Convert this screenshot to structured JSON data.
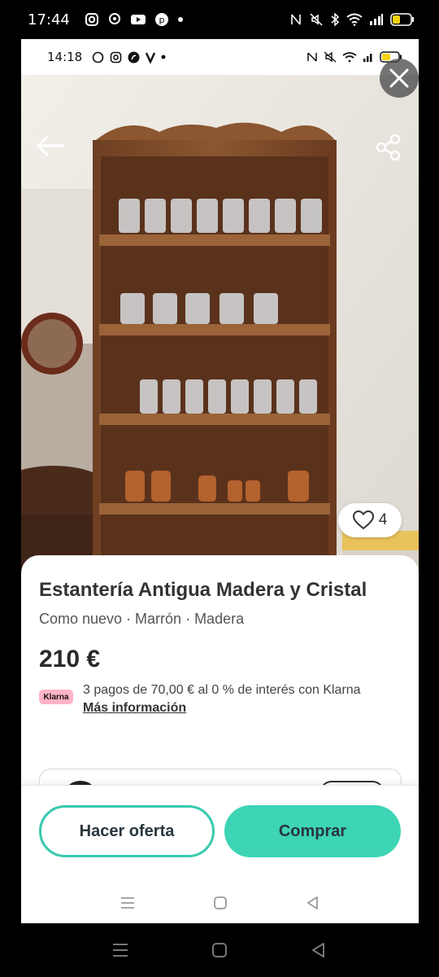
{
  "outer_status": {
    "time": "17:44"
  },
  "inner_status": {
    "time": "14:18"
  },
  "photo": {
    "alt": "Estantería de madera con jarras de cristal"
  },
  "likes": {
    "count": "4"
  },
  "listing": {
    "title": "Estantería Antigua Madera y Cristal",
    "condition": "Como nuevo · Marrón · Madera",
    "price": "210 €",
    "klarna_badge": "Klarna",
    "klarna_text": "3 pagos de 70,00 € al 0 % de interés con Klarna",
    "klarna_link": "Más información"
  },
  "actions": {
    "offer_label": "Hacer oferta",
    "buy_label": "Comprar"
  },
  "colors": {
    "accent": "#3dd5b6",
    "accent_border": "#38c9ad",
    "klarna_pink": "#ffb3c7"
  }
}
